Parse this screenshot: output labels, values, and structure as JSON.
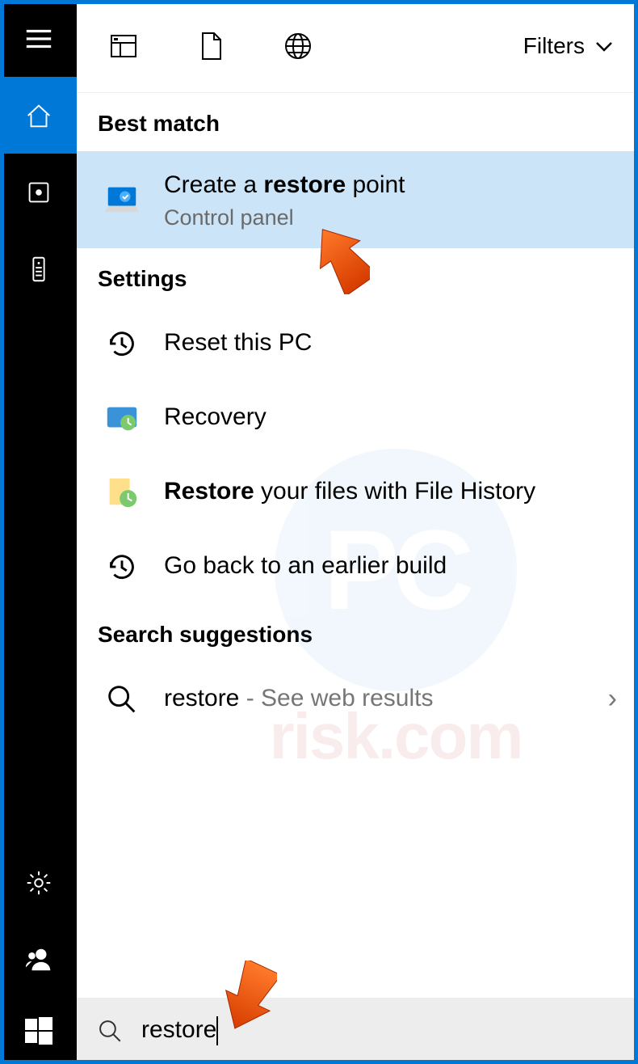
{
  "toolbar": {
    "filters_label": "Filters"
  },
  "sections": {
    "best_match": "Best match",
    "settings": "Settings",
    "suggestions": "Search suggestions"
  },
  "best_result": {
    "title_pre": "Create a ",
    "title_bold": "restore",
    "title_post": " point",
    "subtitle": "Control panel"
  },
  "settings_results": {
    "reset": "Reset this PC",
    "recovery": "Recovery",
    "restore_pre": "Restore",
    "restore_post": " your files with File History",
    "goback": "Go back to an earlier build"
  },
  "suggestion": {
    "term": "restore",
    "hint": " - See web results"
  },
  "search": {
    "value": "restore"
  },
  "watermark": {
    "badge": "PC",
    "text": "risk.com"
  }
}
